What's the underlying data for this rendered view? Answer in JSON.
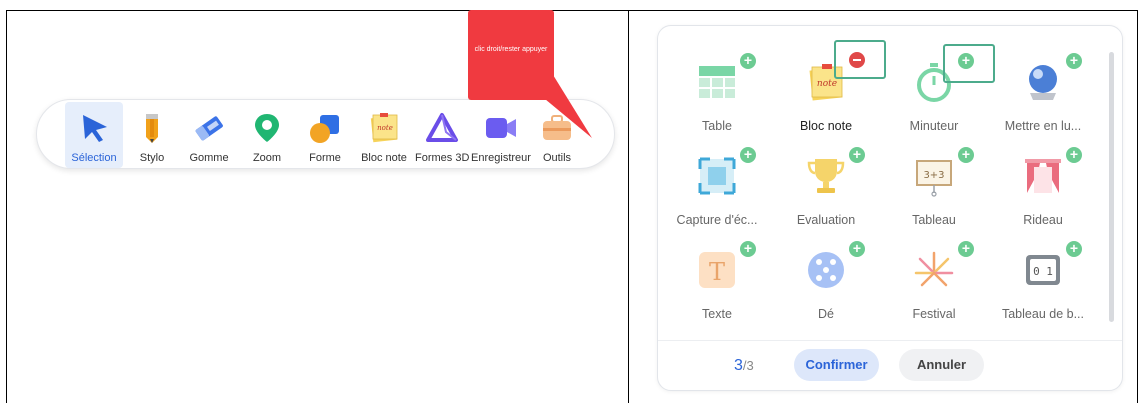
{
  "callout": {
    "text": "clic droit/rester appuyer"
  },
  "toolbar": {
    "tools": [
      {
        "label": "Sélection",
        "icon": "arrow-cursor-icon",
        "selected": true
      },
      {
        "label": "Stylo",
        "icon": "pencil-icon"
      },
      {
        "label": "Gomme",
        "icon": "eraser-icon"
      },
      {
        "label": "Zoom",
        "icon": "map-pin-icon"
      },
      {
        "label": "Forme",
        "icon": "shapes-icon"
      },
      {
        "label": "Bloc note",
        "icon": "sticky-note-icon"
      },
      {
        "label": "Formes 3D",
        "icon": "triangle-3d-icon"
      },
      {
        "label": "Enregistreur",
        "icon": "video-camera-icon"
      },
      {
        "label": "Outils",
        "icon": "toolbox-icon"
      }
    ]
  },
  "dialog": {
    "items": [
      {
        "label": "Table",
        "icon": "table-grid-icon",
        "badge": "plus"
      },
      {
        "label": "Bloc note",
        "icon": "sticky-note-icon",
        "badge": "minus"
      },
      {
        "label": "Minuteur",
        "icon": "stopwatch-icon",
        "badge": "plus"
      },
      {
        "label": "Mettre en lu...",
        "icon": "crystal-ball-icon",
        "badge": "plus"
      },
      {
        "label": "Capture d'éc...",
        "icon": "screenshot-icon",
        "badge": "plus"
      },
      {
        "label": "Evaluation",
        "icon": "trophy-icon",
        "badge": "plus"
      },
      {
        "label": "Tableau",
        "icon": "blackboard-icon",
        "badge": "plus",
        "board_text": "3+3"
      },
      {
        "label": "Rideau",
        "icon": "curtain-icon",
        "badge": "plus"
      },
      {
        "label": "Texte",
        "icon": "text-t-icon",
        "badge": "plus",
        "glyph": "T"
      },
      {
        "label": "Dé",
        "icon": "dice-icon",
        "badge": "plus"
      },
      {
        "label": "Festival",
        "icon": "fireworks-icon",
        "badge": "plus"
      },
      {
        "label": "Tableau de b...",
        "icon": "scoreboard-icon",
        "badge": "plus",
        "board_text": "0 1"
      }
    ],
    "page_current": "3",
    "page_total": "/3",
    "confirm_label": "Confirmer",
    "cancel_label": "Annuler"
  },
  "colors": {
    "accent": "#2b64d8",
    "callout": "#f03a40",
    "add_badge": "#6ccb92",
    "remove_badge": "#e04848",
    "highlight_box": "#4cab8c"
  }
}
